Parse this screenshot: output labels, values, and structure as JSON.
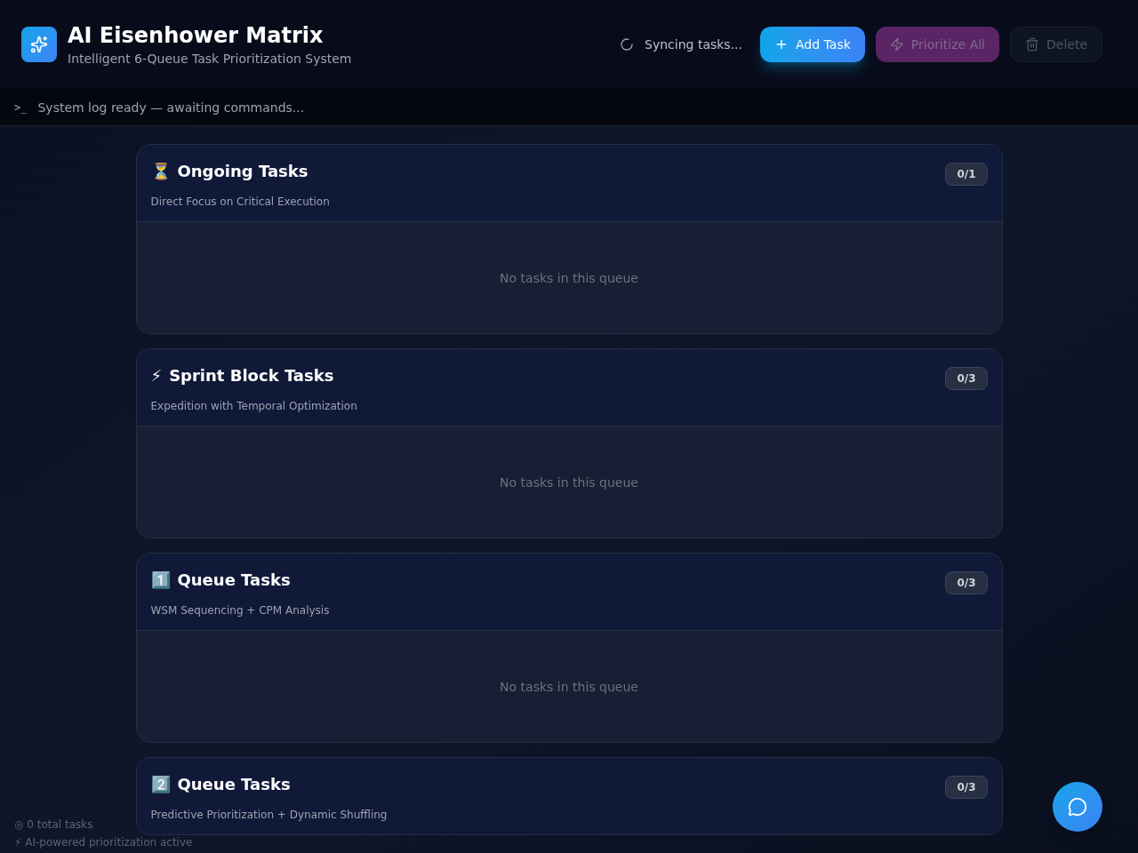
{
  "header": {
    "title": "AI Eisenhower Matrix",
    "subtitle": "Intelligent 6-Queue Task Prioritization System",
    "sync_status": "Syncing tasks...",
    "buttons": [
      {
        "kind": "add",
        "label": "Add Task",
        "disabled": false
      },
      {
        "kind": "prioritize",
        "label": "Prioritize All",
        "disabled": true
      },
      {
        "kind": "delete",
        "label": "Delete",
        "disabled": true
      }
    ]
  },
  "log": {
    "prompt": ">_",
    "message": "System log ready — awaiting commands..."
  },
  "queues": [
    {
      "emoji": "⏳",
      "title": "Ongoing Tasks",
      "subtitle": "Direct Focus on Critical Execution",
      "count": "0/1",
      "empty_text": "No tasks in this queue"
    },
    {
      "emoji": "⚡",
      "title": "Sprint Block Tasks",
      "subtitle": "Expedition with Temporal Optimization",
      "count": "0/3",
      "empty_text": "No tasks in this queue"
    },
    {
      "emoji": "1️⃣",
      "title": "Queue Tasks",
      "subtitle": "WSM Sequencing + CPM Analysis",
      "count": "0/3",
      "empty_text": "No tasks in this queue"
    },
    {
      "emoji": "2️⃣",
      "title": "Queue Tasks",
      "subtitle": "Predictive Prioritization + Dynamic Shuffling",
      "count": "0/3"
    }
  ],
  "footer": {
    "lines": [
      "◎ 0 total tasks",
      "⚡ AI-powered prioritization active"
    ]
  }
}
